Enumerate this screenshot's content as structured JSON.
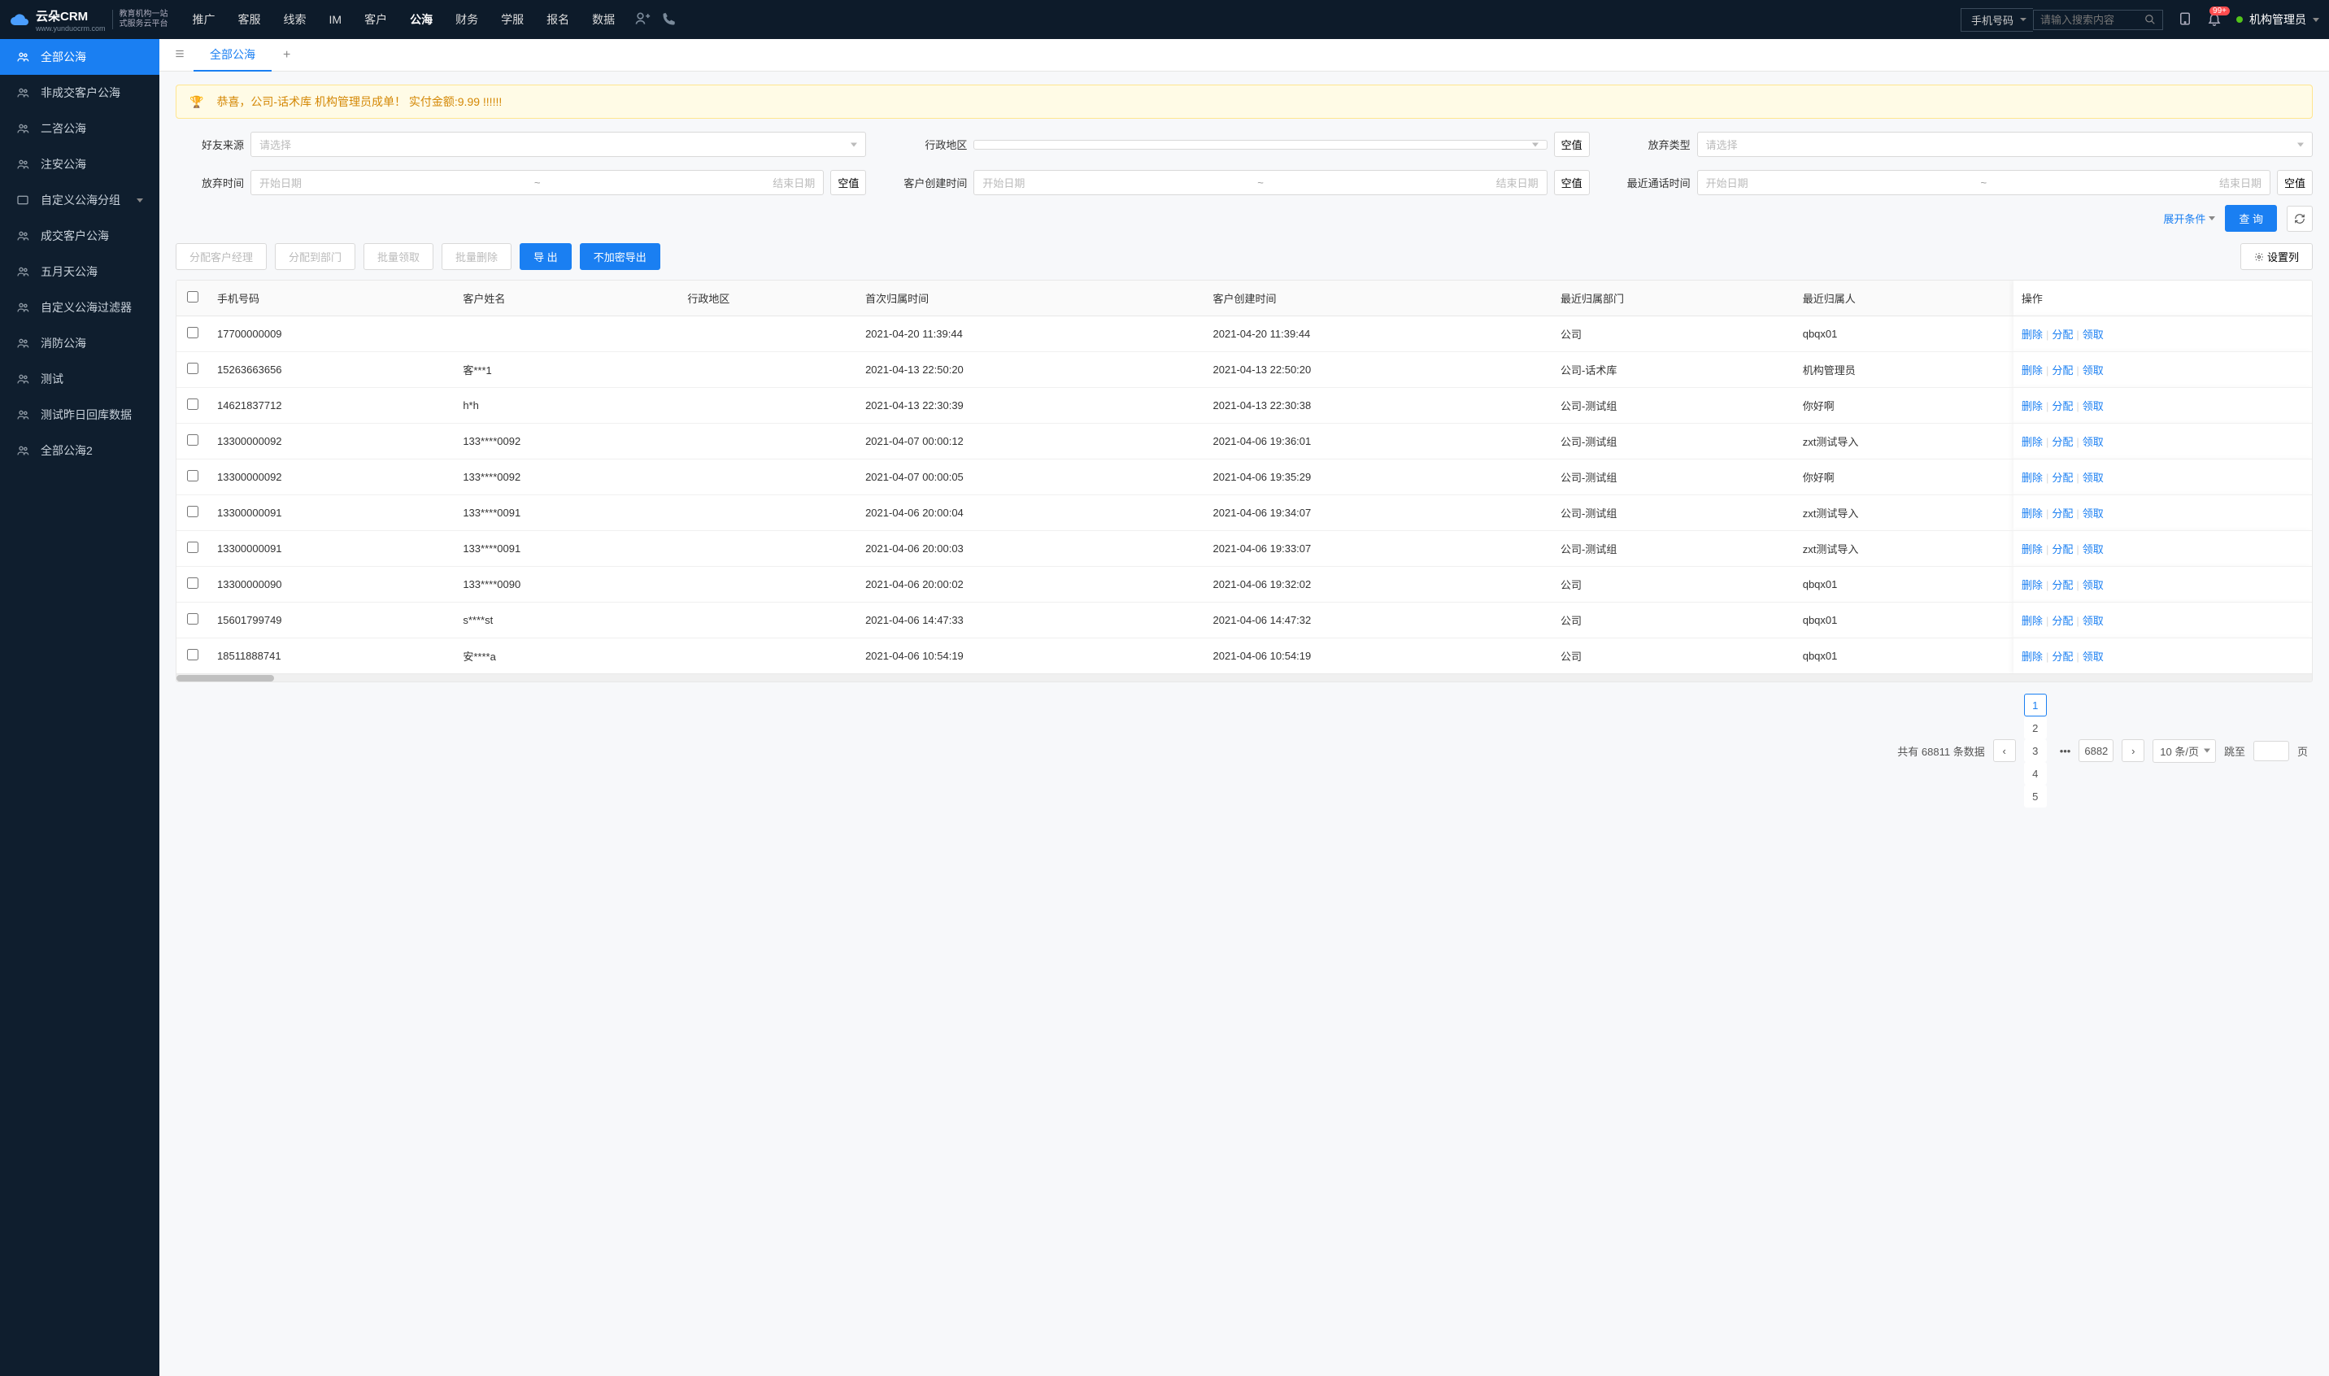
{
  "header": {
    "logo_main": "云朵CRM",
    "logo_url": "www.yunduocrm.com",
    "logo_sub1": "教育机构一站",
    "logo_sub2": "式服务云平台",
    "nav": [
      "推广",
      "客服",
      "线索",
      "IM",
      "客户",
      "公海",
      "财务",
      "学服",
      "报名",
      "数据"
    ],
    "nav_active_index": 5,
    "search_type": "手机号码",
    "search_placeholder": "请输入搜索内容",
    "badge": "99+",
    "user": "机构管理员"
  },
  "sidebar": {
    "items": [
      {
        "label": "全部公海",
        "active": true
      },
      {
        "label": "非成交客户公海"
      },
      {
        "label": "二咨公海"
      },
      {
        "label": "注安公海"
      },
      {
        "label": "自定义公海分组",
        "has_children": true
      },
      {
        "label": "成交客户公海"
      },
      {
        "label": "五月天公海"
      },
      {
        "label": "自定义公海过滤器"
      },
      {
        "label": "消防公海"
      },
      {
        "label": "测试"
      },
      {
        "label": "测试昨日回库数据"
      },
      {
        "label": "全部公海2"
      }
    ]
  },
  "tabs": {
    "items": [
      "全部公海"
    ],
    "active_index": 0
  },
  "banner": "恭喜，公司-话术库  机构管理员成单！  实付金额:9.99 !!!!!!",
  "filters": {
    "source_label": "好友来源",
    "source_placeholder": "请选择",
    "region_label": "行政地区",
    "region_null": "空值",
    "abandon_type_label": "放弃类型",
    "abandon_type_placeholder": "请选择",
    "abandon_time_label": "放弃时间",
    "start_placeholder": "开始日期",
    "end_placeholder": "结束日期",
    "time_null": "空值",
    "create_time_label": "客户创建时间",
    "call_time_label": "最近通话时间",
    "expand": "展开条件",
    "query": "查 询"
  },
  "toolbar": {
    "assign_manager": "分配客户经理",
    "assign_dept": "分配到部门",
    "batch_claim": "批量领取",
    "batch_delete": "批量删除",
    "export": "导 出",
    "export_plain": "不加密导出",
    "set_columns": "设置列"
  },
  "table": {
    "columns": [
      "手机号码",
      "客户姓名",
      "行政地区",
      "首次归属时间",
      "客户创建时间",
      "最近归属部门",
      "最近归属人",
      "操作"
    ],
    "ops": {
      "delete": "删除",
      "assign": "分配",
      "claim": "领取"
    },
    "rows": [
      {
        "phone": "17700000009",
        "name": "",
        "region": "",
        "first": "2021-04-20 11:39:44",
        "created": "2021-04-20 11:39:44",
        "dept": "公司",
        "owner": "qbqx01"
      },
      {
        "phone": "15263663656",
        "name": "客***1",
        "region": "",
        "first": "2021-04-13 22:50:20",
        "created": "2021-04-13 22:50:20",
        "dept": "公司-话术库",
        "owner": "机构管理员"
      },
      {
        "phone": "14621837712",
        "name": "h*h",
        "region": "",
        "first": "2021-04-13 22:30:39",
        "created": "2021-04-13 22:30:38",
        "dept": "公司-测试组",
        "owner": "你好啊"
      },
      {
        "phone": "13300000092",
        "name": "133****0092",
        "region": "",
        "first": "2021-04-07 00:00:12",
        "created": "2021-04-06 19:36:01",
        "dept": "公司-测试组",
        "owner": "zxt测试导入"
      },
      {
        "phone": "13300000092",
        "name": "133****0092",
        "region": "",
        "first": "2021-04-07 00:00:05",
        "created": "2021-04-06 19:35:29",
        "dept": "公司-测试组",
        "owner": "你好啊"
      },
      {
        "phone": "13300000091",
        "name": "133****0091",
        "region": "",
        "first": "2021-04-06 20:00:04",
        "created": "2021-04-06 19:34:07",
        "dept": "公司-测试组",
        "owner": "zxt测试导入"
      },
      {
        "phone": "13300000091",
        "name": "133****0091",
        "region": "",
        "first": "2021-04-06 20:00:03",
        "created": "2021-04-06 19:33:07",
        "dept": "公司-测试组",
        "owner": "zxt测试导入"
      },
      {
        "phone": "13300000090",
        "name": "133****0090",
        "region": "",
        "first": "2021-04-06 20:00:02",
        "created": "2021-04-06 19:32:02",
        "dept": "公司",
        "owner": "qbqx01"
      },
      {
        "phone": "15601799749",
        "name": "s****st",
        "region": "",
        "first": "2021-04-06 14:47:33",
        "created": "2021-04-06 14:47:32",
        "dept": "公司",
        "owner": "qbqx01"
      },
      {
        "phone": "18511888741",
        "name": "安****a",
        "region": "",
        "first": "2021-04-06 10:54:19",
        "created": "2021-04-06 10:54:19",
        "dept": "公司",
        "owner": "qbqx01"
      }
    ]
  },
  "pagination": {
    "total_prefix": "共有 ",
    "total": "68811",
    "total_suffix": " 条数据",
    "pages": [
      "1",
      "2",
      "3",
      "4",
      "5"
    ],
    "last_page": "6882",
    "page_size": "10 条/页",
    "jump_prefix": "跳至",
    "jump_suffix": "页"
  }
}
